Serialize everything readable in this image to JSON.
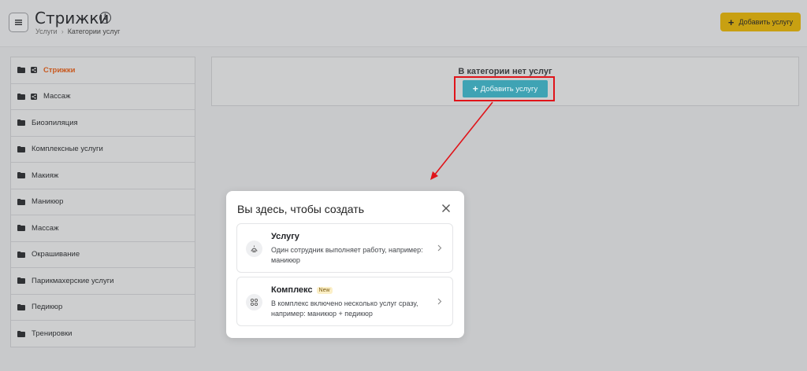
{
  "header": {
    "title": "Стрижки",
    "breadcrumb": [
      "Услуги",
      "Категории услуг"
    ],
    "add_button_label": "Добавить услугу"
  },
  "sidebar": {
    "items": [
      {
        "label": "Стрижки",
        "active": true,
        "icons": [
          "folder-icon",
          "share-icon"
        ]
      },
      {
        "label": "Массаж",
        "active": false,
        "icons": [
          "folder-icon",
          "share-icon"
        ]
      },
      {
        "label": "Биоэпиляция",
        "active": false,
        "icons": [
          "folder-icon"
        ]
      },
      {
        "label": "Комплексные услуги",
        "active": false,
        "icons": [
          "folder-icon"
        ]
      },
      {
        "label": "Макияж",
        "active": false,
        "icons": [
          "folder-icon"
        ]
      },
      {
        "label": "Маникюр",
        "active": false,
        "icons": [
          "folder-icon"
        ]
      },
      {
        "label": "Массаж",
        "active": false,
        "icons": [
          "folder-icon"
        ]
      },
      {
        "label": "Окрашивание",
        "active": false,
        "icons": [
          "folder-icon"
        ]
      },
      {
        "label": "Парикмахерские услуги",
        "active": false,
        "icons": [
          "folder-icon"
        ]
      },
      {
        "label": "Педикюр",
        "active": false,
        "icons": [
          "folder-icon"
        ]
      },
      {
        "label": "Тренировки",
        "active": false,
        "icons": [
          "folder-icon"
        ]
      }
    ]
  },
  "main": {
    "empty_text": "В категории нет услуг",
    "add_button_label": "Добавить услугу"
  },
  "modal": {
    "title": "Вы здесь, чтобы создать",
    "options": [
      {
        "title": "Услугу",
        "badge": "",
        "description": "Один сотрудник выполняет работу, например: маникюр",
        "icon": "service-icon"
      },
      {
        "title": "Комплекс",
        "badge": "New",
        "description": "В комплекс включено несколько услуг сразу, например: маникюр + педикюр",
        "icon": "complex-icon"
      }
    ]
  },
  "colors": {
    "accent_orange": "#c8591f",
    "add_button_yellow": "#c8a012",
    "add_inline_teal": "#3fa3b4",
    "annotation_red": "#e0141a"
  }
}
